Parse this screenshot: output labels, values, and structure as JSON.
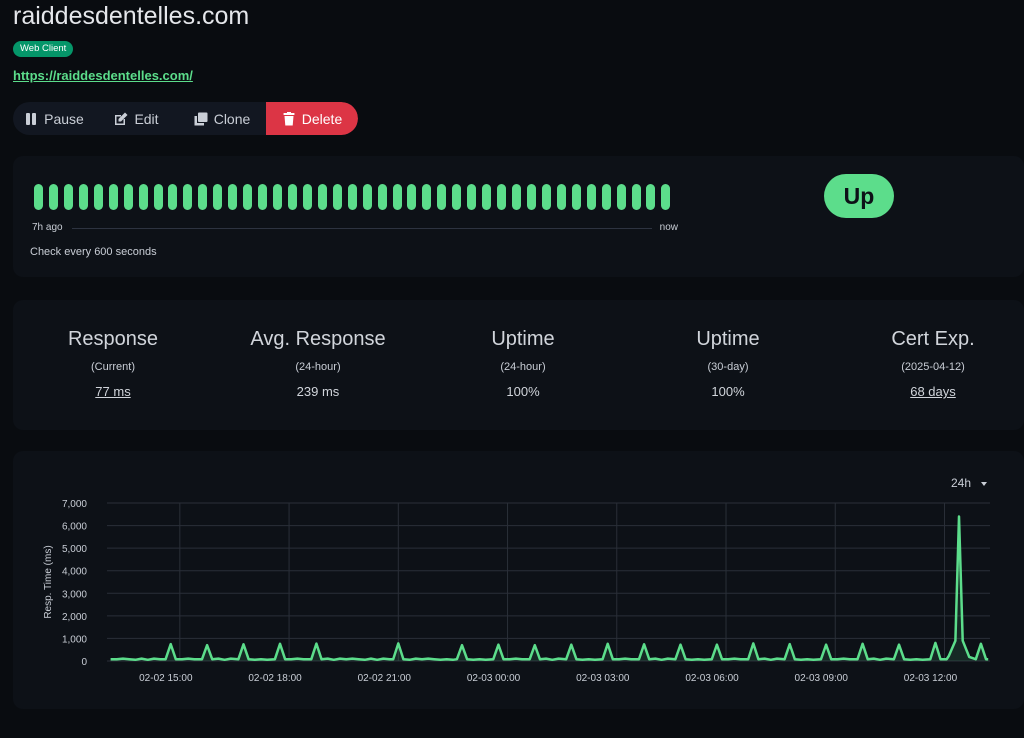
{
  "monitor": {
    "name": "raiddesdentelles.com",
    "tag": "Web Client",
    "url": "https://raiddesdentelles.com/"
  },
  "actions": {
    "pause": "Pause",
    "edit": "Edit",
    "clone": "Clone",
    "delete": "Delete"
  },
  "heartbeat": {
    "beat_count": 43,
    "beat_status": "up",
    "start_label": "7h ago",
    "end_label": "now",
    "interval_text": "Check every 600 seconds",
    "status": "Up"
  },
  "stats": [
    {
      "title": "Response",
      "sub": "(Current)",
      "value": "77 ms",
      "link": true
    },
    {
      "title": "Avg. Response",
      "sub": "(24-hour)",
      "value": "239 ms",
      "link": false
    },
    {
      "title": "Uptime",
      "sub": "(24-hour)",
      "value": "100%",
      "link": false
    },
    {
      "title": "Uptime",
      "sub": "(30-day)",
      "value": "100%",
      "link": false
    },
    {
      "title": "Cert Exp.",
      "sub": "(2025-04-12)",
      "value": "68 days",
      "link": true
    }
  ],
  "chart_range": "24h",
  "colors": {
    "accent": "#5cdd8b",
    "danger": "#dc3545",
    "tag": "#059669"
  },
  "chart_data": {
    "type": "line",
    "ylabel": "Resp. Time (ms)",
    "xlabel": "",
    "ylim": [
      0,
      7000
    ],
    "y_ticks": [
      0,
      1000,
      2000,
      3000,
      4000,
      5000,
      6000,
      7000
    ],
    "y_tick_labels": [
      "0",
      "1,000",
      "2,000",
      "3,000",
      "4,000",
      "5,000",
      "6,000",
      "7,000"
    ],
    "x_ticks": [
      "02-02 15:00",
      "02-02 18:00",
      "02-02 21:00",
      "02-03 00:00",
      "02-03 03:00",
      "02-03 06:00",
      "02-03 09:00",
      "02-03 12:00"
    ],
    "x_range_hours": [
      13.0,
      37.25
    ],
    "baseline_ms": 80,
    "spikes": [
      {
        "t": 14.75,
        "ms": 750
      },
      {
        "t": 15.75,
        "ms": 700
      },
      {
        "t": 16.75,
        "ms": 740
      },
      {
        "t": 17.75,
        "ms": 760
      },
      {
        "t": 18.75,
        "ms": 770
      },
      {
        "t": 21.0,
        "ms": 780
      },
      {
        "t": 22.75,
        "ms": 700
      },
      {
        "t": 23.75,
        "ms": 720
      },
      {
        "t": 24.75,
        "ms": 700
      },
      {
        "t": 25.75,
        "ms": 720
      },
      {
        "t": 26.75,
        "ms": 760
      },
      {
        "t": 27.75,
        "ms": 740
      },
      {
        "t": 28.75,
        "ms": 720
      },
      {
        "t": 29.75,
        "ms": 720
      },
      {
        "t": 30.75,
        "ms": 780
      },
      {
        "t": 31.75,
        "ms": 750
      },
      {
        "t": 32.75,
        "ms": 720
      },
      {
        "t": 33.75,
        "ms": 760
      },
      {
        "t": 34.75,
        "ms": 720
      },
      {
        "t": 35.75,
        "ms": 800
      },
      {
        "t": 36.4,
        "ms": 6400
      },
      {
        "t": 37.0,
        "ms": 760
      }
    ]
  }
}
